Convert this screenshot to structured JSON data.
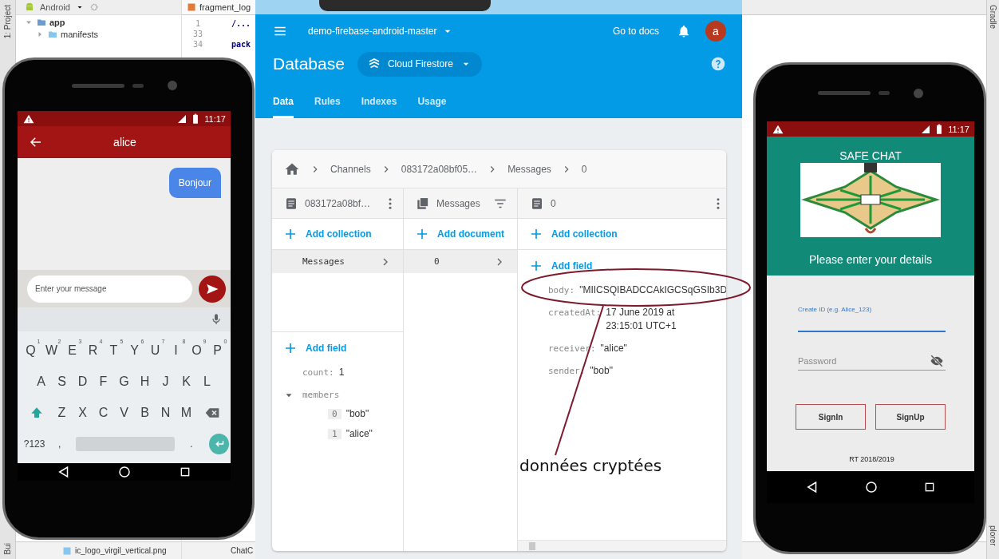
{
  "ide": {
    "side_tab": "1: Project",
    "view_selector": "Android",
    "tree": [
      {
        "label": "app",
        "kind": "module"
      },
      {
        "label": "manifests",
        "kind": "folder"
      }
    ],
    "editor_tab": "fragment_log",
    "line_numbers": [
      "1",
      "33",
      "34"
    ],
    "code_lines": [
      "/...",
      "pack"
    ],
    "bottom_file": "ic_logo_virgil_vertical.png",
    "bottom_tab": "ChatC",
    "bottom_side_tab": "Bui",
    "right_tab": "Gradle",
    "right_bottom_tab": "plorer"
  },
  "browser": {
    "project": "demo-firebase-android-master",
    "docs_link": "Go to docs",
    "avatar": "a",
    "title": "Database",
    "db_selector": "Cloud Firestore",
    "tabs": [
      {
        "label": "Data",
        "selected": true
      },
      {
        "label": "Rules",
        "selected": false
      },
      {
        "label": "Indexes",
        "selected": false
      },
      {
        "label": "Usage",
        "selected": false
      }
    ],
    "breadcrumb": [
      "Channels",
      "083172a08bf05…",
      "Messages",
      "0"
    ],
    "columns": [
      {
        "kind": "document",
        "header": "083172a08bf…",
        "action": "Add collection",
        "items": [
          {
            "label": "Messages",
            "selected": true
          }
        ],
        "add_field": "Add field",
        "fields": [
          {
            "key": "count:",
            "value": "1"
          },
          {
            "key": "members",
            "expanded": true,
            "children": [
              {
                "index": "0",
                "value": "\"bob\""
              },
              {
                "index": "1",
                "value": "\"alice\""
              }
            ]
          }
        ]
      },
      {
        "kind": "collection",
        "header": "Messages",
        "action": "Add document",
        "items": [
          {
            "label": "0",
            "selected": true
          }
        ]
      },
      {
        "kind": "document",
        "header": "0",
        "action": "Add collection",
        "add_field": "Add field",
        "fields": [
          {
            "key": "body:",
            "value": "\"MIICSQIBADCCAkIGCSqGSIb3D"
          },
          {
            "key": "createdAt:",
            "value": "17 June 2019 at 23:15:01 UTC+1"
          },
          {
            "key": "receiver:",
            "value": "\"alice\""
          },
          {
            "key": "sender:",
            "value": "\"bob\""
          }
        ]
      }
    ]
  },
  "annotation": {
    "text": "données cryptées"
  },
  "chat_phone": {
    "time": "11:17",
    "title": "alice",
    "messages": [
      {
        "text": "Bonjour",
        "outgoing": true
      }
    ],
    "input": {
      "placeholder": "Enter your message"
    },
    "keyboard": [
      [
        {
          "kind": "key",
          "label": "Q",
          "hint": "1"
        },
        {
          "kind": "key",
          "label": "W",
          "hint": "2"
        },
        {
          "kind": "key",
          "label": "E",
          "hint": "3"
        },
        {
          "kind": "key",
          "label": "R",
          "hint": "4"
        },
        {
          "kind": "key",
          "label": "T",
          "hint": "5"
        },
        {
          "kind": "key",
          "label": "Y",
          "hint": "6"
        },
        {
          "kind": "key",
          "label": "U",
          "hint": "7"
        },
        {
          "kind": "key",
          "label": "I",
          "hint": "8"
        },
        {
          "kind": "key",
          "label": "O",
          "hint": "9"
        },
        {
          "kind": "key",
          "label": "P",
          "hint": "0"
        }
      ],
      [
        {
          "kind": "key",
          "label": "A"
        },
        {
          "kind": "key",
          "label": "S"
        },
        {
          "kind": "key",
          "label": "D"
        },
        {
          "kind": "key",
          "label": "F"
        },
        {
          "kind": "key",
          "label": "G"
        },
        {
          "kind": "key",
          "label": "H"
        },
        {
          "kind": "key",
          "label": "J"
        },
        {
          "kind": "key",
          "label": "K"
        },
        {
          "kind": "key",
          "label": "L"
        }
      ],
      [
        {
          "kind": "shift"
        },
        {
          "kind": "key",
          "label": "Z"
        },
        {
          "kind": "key",
          "label": "X"
        },
        {
          "kind": "key",
          "label": "C"
        },
        {
          "kind": "key",
          "label": "V"
        },
        {
          "kind": "key",
          "label": "B"
        },
        {
          "kind": "key",
          "label": "N"
        },
        {
          "kind": "key",
          "label": "M"
        },
        {
          "kind": "backspace"
        }
      ],
      [
        {
          "kind": "key",
          "label": "?123"
        },
        {
          "kind": "key",
          "label": ","
        },
        {
          "kind": "space"
        },
        {
          "kind": "key",
          "label": "."
        },
        {
          "kind": "enter"
        }
      ]
    ]
  },
  "login_phone": {
    "time": "11:17",
    "app_title": "SAFE CHAT",
    "subtitle": "Please enter your details",
    "fields": [
      {
        "kind": "floating",
        "label": "Create ID (e.g. Alice_123)",
        "focused": true
      },
      {
        "kind": "password",
        "placeholder": "Password",
        "focused": false
      }
    ],
    "buttons": [
      "SignIn",
      "SignUp"
    ],
    "footer": "RT 2018/2019"
  }
}
